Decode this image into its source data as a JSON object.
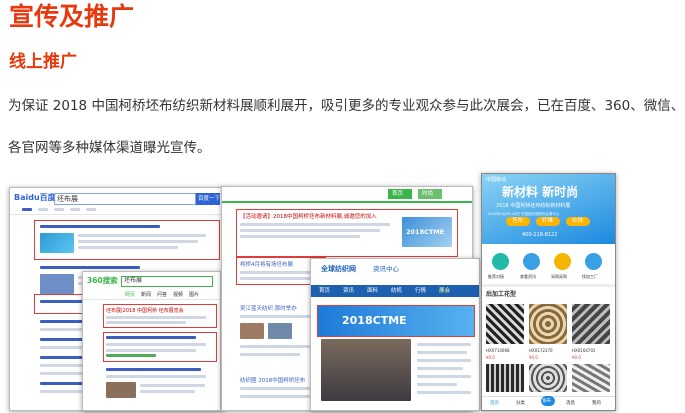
{
  "heading": "宣传及推广",
  "subheading": "线上推广",
  "paragraph": {
    "line1": "为保证 2018 中国柯桥坯布纺织新材料展顺利展开，吸引更多的专业观众参与此次展会，已在百度、360、微信、",
    "line2": "各官网等多种媒体渠道曝光宣传。"
  },
  "screens": {
    "baidu": {
      "logo": "Baidu百度",
      "query": "坯布展",
      "search_button": "百度一下"
    },
    "so360": {
      "logo": "360搜索",
      "query": "坯布展",
      "result_title": "坯布展|2018 中国柯桥 坯布展览会",
      "tabs": [
        "网页",
        "新闻",
        "问答",
        "视频",
        "图片"
      ]
    },
    "news_site": {
      "result_title": "【活动邀请】2018中国柯桥坯布新材料展,诚邀您的加入",
      "banner_text": "2018CTME",
      "item_title": "柯桥4月将有场坯布展",
      "item_title2": "吴江蓝天纺织 那时举办",
      "item_title3": "纺织圈 2018中国柯桥坯布",
      "tag1": "首页",
      "tag2": "时尚"
    },
    "qfz": {
      "logo": "全球纺织网",
      "section": "资讯中心",
      "nav": [
        "首页",
        "资讯",
        "面料",
        "纺机",
        "行情",
        "展会"
      ],
      "banner_text": "2018CTME"
    },
    "mobile": {
      "status_time": "中国移动",
      "hero_title": "新材料 新时尚",
      "hero_sub": "2018 中国柯桥坯布纺织新材料展",
      "hero_date": "2018年4月26-28日 中国轻纺城国际会展中心",
      "chips": [
        "坯布",
        "纤维",
        "纱线"
      ],
      "hotline": "400-118-8122",
      "icons": [
        "推荐对接",
        "查看资讯",
        "采购采购",
        "找加工厂"
      ],
      "section_title": "后加工花型",
      "items": [
        {
          "code": "HX0714068",
          "price": "¥0.0"
        },
        {
          "code": "HX0172370",
          "price": "¥0.0"
        },
        {
          "code": "HX0104702",
          "price": "¥0.0"
        }
      ],
      "tabbar": [
        "首页",
        "分类",
        "发布",
        "消息",
        "我的"
      ]
    }
  },
  "colors": {
    "heading": "#e8380d",
    "text": "#333333",
    "baidu_blue": "#2e65d6",
    "so360_green": "#3ab54a",
    "mobile_accent": "#1c8ae0"
  }
}
